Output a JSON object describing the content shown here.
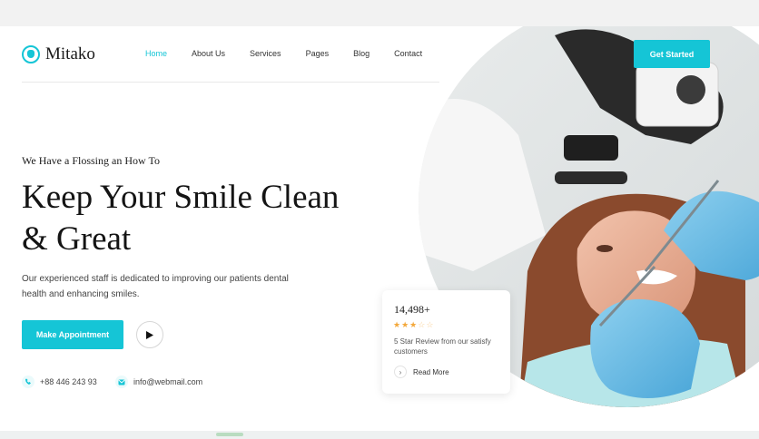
{
  "brand": {
    "name": "Mitako",
    "logo_icon": "tooth-icon",
    "accent": "#15c5d6"
  },
  "nav": {
    "items": [
      {
        "label": "Home",
        "active": true
      },
      {
        "label": "About Us"
      },
      {
        "label": "Services"
      },
      {
        "label": "Pages"
      },
      {
        "label": "Blog"
      },
      {
        "label": "Contact"
      }
    ],
    "cta_label": "Get Started"
  },
  "hero": {
    "eyebrow": "We Have a Flossing an How To",
    "headline_line1": "Keep Your Smile Clean",
    "headline_line2": "& Great",
    "description": "Our experienced staff is dedicated to improving our patients dental health and enhancing smiles.",
    "appointment_label": "Make Appointment",
    "play_icon": "play-icon"
  },
  "contact": {
    "phone": "+88 446 243 93",
    "email": "info@webmail.com"
  },
  "review_card": {
    "count": "14,498+",
    "rating_stars": 3,
    "rating_max": 5,
    "text": "5 Star Review from our satisfy customers",
    "link_label": "Read More"
  }
}
